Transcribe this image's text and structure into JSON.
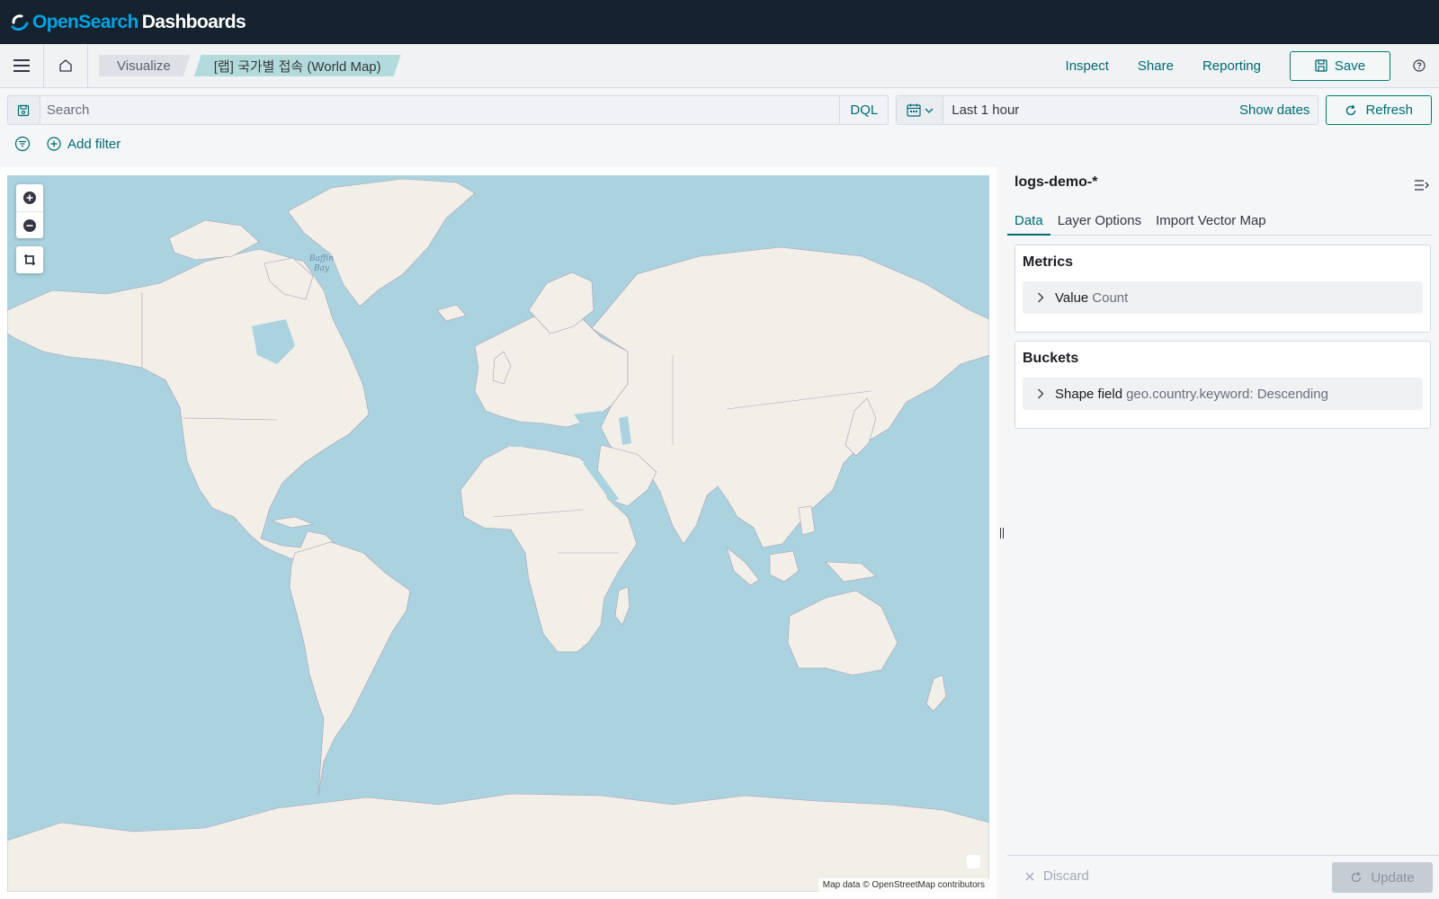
{
  "header": {
    "logo_open": "OpenSearch",
    "logo_dashboards": "Dashboards"
  },
  "nav": {
    "breadcrumbs": [
      "Visualize",
      "[랩] 국가별 접속 (World Map)"
    ],
    "links": {
      "inspect": "Inspect",
      "share": "Share",
      "reporting": "Reporting"
    },
    "save_label": "Save"
  },
  "query": {
    "search_placeholder": "Search",
    "search_value": "",
    "language": "DQL",
    "time_range": "Last 1 hour",
    "show_dates": "Show dates",
    "refresh_label": "Refresh"
  },
  "filters": {
    "add_filter_label": "Add filter"
  },
  "map": {
    "label_baffin": "Baffin\nBay",
    "attribution": "Map data © OpenStreetMap contributors",
    "colors": {
      "water": "#aad3df",
      "land": "#f2efe9",
      "border": "#a99fb3"
    }
  },
  "editor": {
    "index_pattern": "logs-demo-*",
    "tabs": [
      {
        "label": "Data",
        "active": true
      },
      {
        "label": "Layer Options",
        "active": false
      },
      {
        "label": "Import Vector Map",
        "active": false
      }
    ],
    "metrics": {
      "title": "Metrics",
      "items": [
        {
          "label": "Value",
          "value": "Count"
        }
      ]
    },
    "buckets": {
      "title": "Buckets",
      "items": [
        {
          "label": "Shape field",
          "value": "geo.country.keyword: Descending"
        }
      ]
    },
    "discard_label": "Discard",
    "update_label": "Update"
  },
  "colors": {
    "accent": "#016b74",
    "header_bg": "#15222f"
  }
}
